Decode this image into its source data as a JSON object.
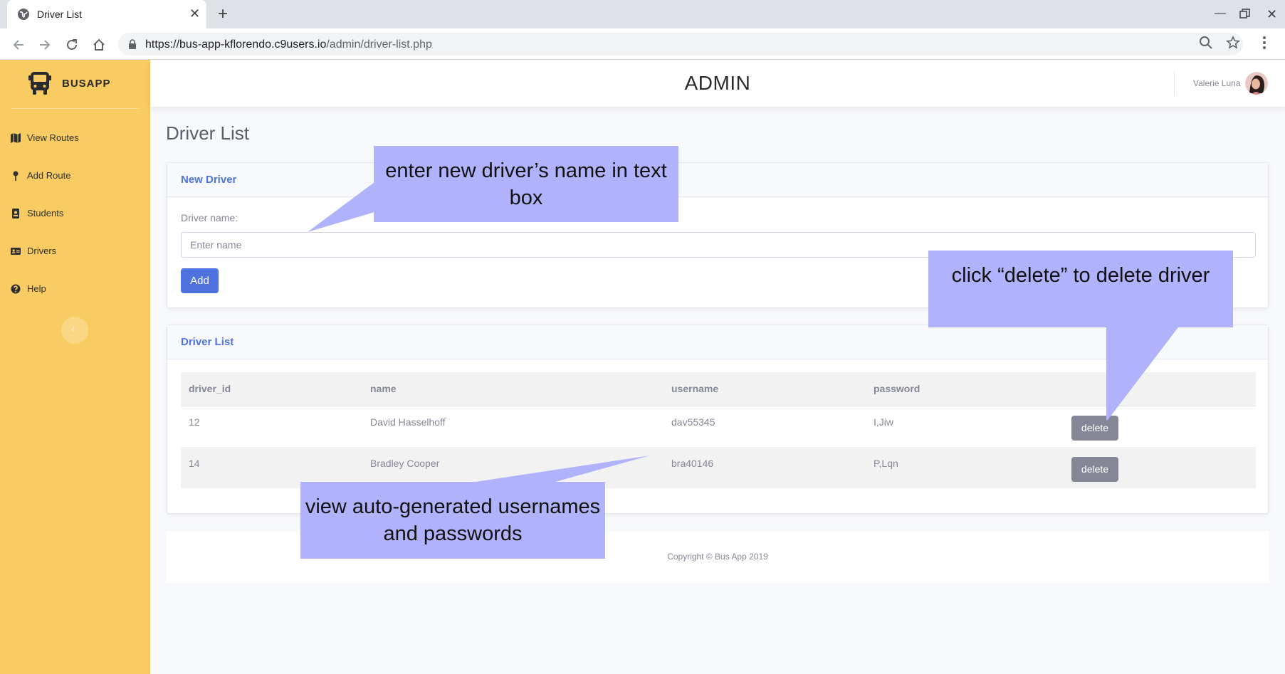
{
  "browser": {
    "tab_title": "Driver List",
    "url_host": "https://bus-app-kflorendo.c9users.io",
    "url_path": "/admin/driver-list.php"
  },
  "sidebar": {
    "brand": "BUSAPP",
    "items": [
      {
        "label": "View Routes",
        "icon": "map-icon"
      },
      {
        "label": "Add Route",
        "icon": "map-pin-icon"
      },
      {
        "label": "Students",
        "icon": "id-badge-icon"
      },
      {
        "label": "Drivers",
        "icon": "id-card-icon"
      },
      {
        "label": "Help",
        "icon": "question-circle-icon"
      }
    ]
  },
  "topbar": {
    "heading": "ADMIN",
    "user_name": "Valerie Luna"
  },
  "page_title": "Driver List",
  "new_driver": {
    "card_title": "New Driver",
    "field_label": "Driver name:",
    "placeholder": "Enter name",
    "add_label": "Add"
  },
  "driver_list": {
    "card_title": "Driver List",
    "columns": [
      "driver_id",
      "name",
      "username",
      "password",
      ""
    ],
    "rows": [
      {
        "driver_id": "12",
        "name": "David Hasselhoff",
        "username": "dav55345",
        "password": "I,Jiw",
        "action": "delete"
      },
      {
        "driver_id": "14",
        "name": "Bradley Cooper",
        "username": "bra40146",
        "password": "P,Lqn",
        "action": "delete"
      }
    ]
  },
  "footer": {
    "copyright": "Copyright © Bus App 2019"
  },
  "annotations": {
    "name_box": "enter new driver’s name in text box",
    "delete": "click “delete” to delete driver",
    "credentials": "view auto-generated usernames and passwords"
  },
  "colors": {
    "sidebar": "#f9cc63",
    "primary": "#4e73df",
    "secondary": "#858796",
    "callout": "#b0b3fb"
  }
}
